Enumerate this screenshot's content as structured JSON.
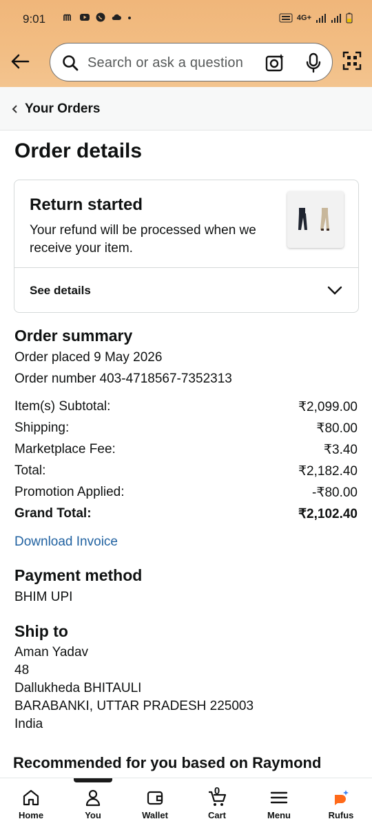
{
  "status_bar": {
    "time": "9:01",
    "network_label": "4G+"
  },
  "search": {
    "placeholder": "Search or ask a question"
  },
  "breadcrumb": {
    "label": "Your Orders"
  },
  "page_title": "Order details",
  "return_card": {
    "title": "Return started",
    "description": "Your refund will be processed when we receive your item.",
    "see_details": "See details"
  },
  "order_summary": {
    "title": "Order summary",
    "placed": "Order placed 9 May 2026",
    "number": "Order number 403-4718567-7352313",
    "rows": [
      {
        "label": "Item(s) Subtotal:",
        "value": "₹2,099.00"
      },
      {
        "label": "Shipping:",
        "value": "₹80.00"
      },
      {
        "label": "Marketplace Fee:",
        "value": "₹3.40"
      },
      {
        "label": "Total:",
        "value": "₹2,182.40"
      },
      {
        "label": "Promotion Applied:",
        "value": "-₹80.00"
      },
      {
        "label": "Grand Total:",
        "value": "₹2,102.40"
      }
    ],
    "download_invoice": "Download Invoice"
  },
  "payment": {
    "title": "Payment method",
    "method": "BHIM UPI"
  },
  "ship_to": {
    "title": "Ship to",
    "lines": [
      "Aman Yadav",
      "48",
      "Dallukheda BHITAULI",
      "BARABANKI, UTTAR PRADESH 225003",
      "India"
    ]
  },
  "recommendation_heading": "Recommended for you based on Raymond",
  "bottom_nav": {
    "items": [
      {
        "label": "Home",
        "icon": "home-icon"
      },
      {
        "label": "You",
        "icon": "person-icon"
      },
      {
        "label": "Wallet",
        "icon": "wallet-icon"
      },
      {
        "label": "Cart",
        "icon": "cart-icon",
        "count": "0"
      },
      {
        "label": "Menu",
        "icon": "menu-icon"
      },
      {
        "label": "Rufus",
        "icon": "rufus-icon"
      }
    ]
  },
  "colors": {
    "header": "#f2bd83",
    "link": "#2162a1",
    "text": "#0f1111",
    "rufus_orange": "#ff6a1a",
    "rufus_blue": "#3b82f6"
  }
}
